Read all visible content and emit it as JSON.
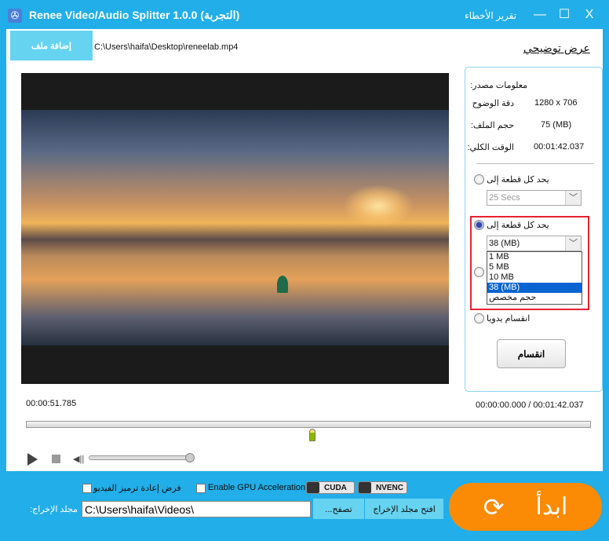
{
  "window": {
    "title": "Renee Video/Audio Splitter 1.0.0 (التجربة)",
    "error_report": "تقرير الأخطاء",
    "minimize": "—",
    "maximize": "☐",
    "close": "X"
  },
  "toolbar": {
    "add_file": "إضافة ملف",
    "file_path": "C:\\Users\\haifa\\Desktop\\reneelab.mp4",
    "demo": "عرض توضيحي"
  },
  "source_info": {
    "heading": "معلومات مصدر:",
    "rows": [
      {
        "label": "دقة الوضوح",
        "value": "1280 x 706"
      },
      {
        "label": "حجم الملف:",
        "value": "75 (MB)"
      },
      {
        "label": "الوقت الكلي:",
        "value": "00:01:42.037"
      }
    ]
  },
  "split_options": {
    "by_time_label": "يحد كل قطعة إلى",
    "by_time_value": "25 Secs",
    "by_size_label": "يحد كل قطعة إلى",
    "by_size_value": "38 (MB)",
    "size_options": [
      "1 MB",
      "5 MB",
      "10 MB",
      "38 (MB)",
      "حجم مخصص"
    ],
    "selected_option": "38 (MB)",
    "manual_label": "انقسام يدويا",
    "split_button": "انقسام"
  },
  "player": {
    "current_time": "00:00:51.785",
    "range": "00:00:00.000 / 00:01:42.037",
    "position_fraction": 0.507,
    "volume_fraction": 1.0
  },
  "bottom": {
    "force_reencode": "فرض إعادة ترميز الفيديو",
    "gpu": "Enable GPU Acceleration",
    "cuda": "CUDA",
    "nvenc": "NVENC",
    "output_label": "مجلد الإخراج:",
    "output_path": "C:\\Users\\haifa\\Videos\\",
    "browse": "...تصفح",
    "open_folder": "افتح مجلد الإخراج",
    "start": "ابدأ"
  },
  "colors": {
    "accent": "#22aee8",
    "start": "#fb8a05",
    "button": "#66d4f1",
    "highlight": "#e62130"
  }
}
